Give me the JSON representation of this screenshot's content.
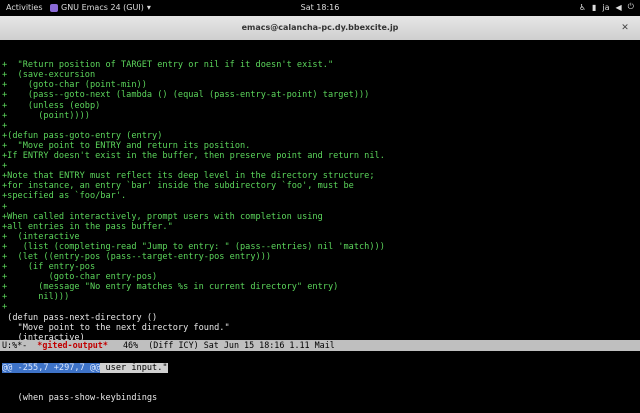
{
  "topbar": {
    "activities": "Activities",
    "app": "GNU Emacs 24 (GUI)",
    "clock": "Sat 18:16",
    "lang": "ja"
  },
  "window": {
    "title": "emacs@calancha-pc.dy.bbexcite.jp"
  },
  "code_lines": [
    {
      "cls": "add",
      "text": "+  \"Return position of TARGET entry or nil if it doesn't exist.\""
    },
    {
      "cls": "add",
      "text": "+  (save-excursion"
    },
    {
      "cls": "add",
      "text": "+    (goto-char (point-min))"
    },
    {
      "cls": "add",
      "text": "+    (pass--goto-next (lambda () (equal (pass-entry-at-point) target)))"
    },
    {
      "cls": "add",
      "text": "+    (unless (eobp)"
    },
    {
      "cls": "add",
      "text": "+      (point))))"
    },
    {
      "cls": "add",
      "text": "+"
    },
    {
      "cls": "add",
      "text": "+(defun pass-goto-entry (entry)"
    },
    {
      "cls": "add",
      "text": "+  \"Move point to ENTRY and return its position."
    },
    {
      "cls": "add",
      "text": "+If ENTRY doesn't exist in the buffer, then preserve point and return nil."
    },
    {
      "cls": "add",
      "text": "+"
    },
    {
      "cls": "add",
      "text": "+Note that ENTRY must reflect its deep level in the directory structure;"
    },
    {
      "cls": "add",
      "text": "+for instance, an entry `bar' inside the subdirectory `foo', must be"
    },
    {
      "cls": "add",
      "text": "+specified as `foo/bar'."
    },
    {
      "cls": "add",
      "text": "+"
    },
    {
      "cls": "add",
      "text": "+When called interactively, prompt users with completion using"
    },
    {
      "cls": "add",
      "text": "+all entries in the pass buffer.\""
    },
    {
      "cls": "add",
      "text": "+  (interactive"
    },
    {
      "cls": "add",
      "text": "+   (list (completing-read \"Jump to entry: \" (pass--entries) nil 'match)))"
    },
    {
      "cls": "add",
      "text": "+  (let ((entry-pos (pass--target-entry-pos entry)))"
    },
    {
      "cls": "add",
      "text": "+    (if entry-pos"
    },
    {
      "cls": "add",
      "text": "+        (goto-char entry-pos)"
    },
    {
      "cls": "add",
      "text": "+      (message \"No entry matches %s in current directory\" entry)"
    },
    {
      "cls": "add",
      "text": "+      nil)))"
    },
    {
      "cls": "add",
      "text": "+"
    },
    {
      "cls": "ctx",
      "text": " (defun pass-next-directory ()"
    },
    {
      "cls": "ctx",
      "text": "   \"Move point to the next directory found.\""
    },
    {
      "cls": "ctx",
      "text": "   (interactive)"
    }
  ],
  "hunk": {
    "header": "@@ -255,7 +297,7 @@",
    "context": " user input.\""
  },
  "after_hunk": "   (when pass-show-keybindings",
  "modeline": {
    "left": "U:%*-  ",
    "buffer": "*gited-output*",
    "right": "   46%  (Diff ICY) Sat Jun 15 18:16 1.11 Mail"
  }
}
